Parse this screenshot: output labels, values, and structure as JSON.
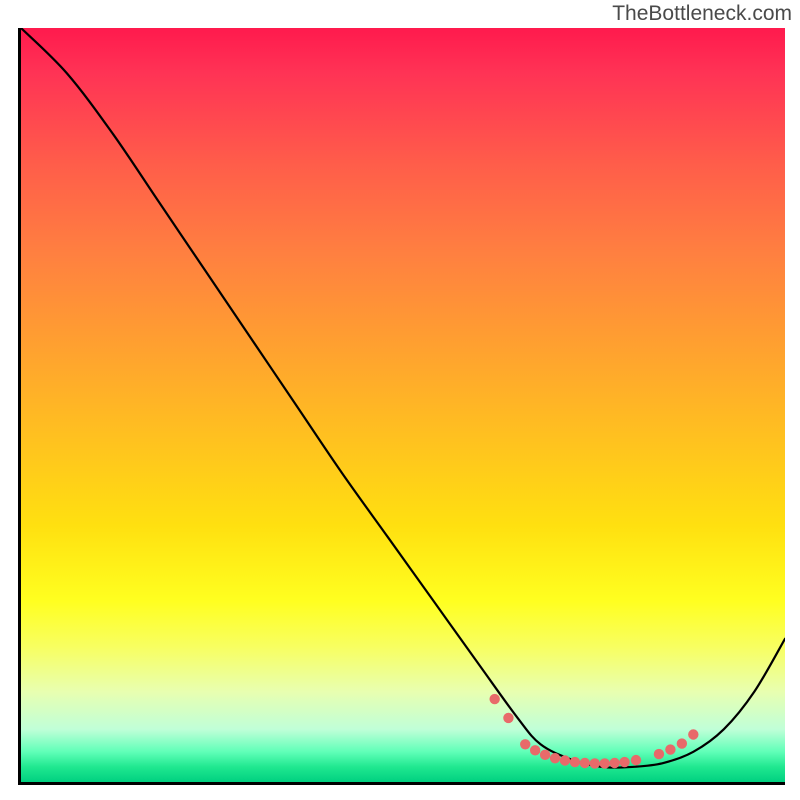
{
  "watermark": "TheBottleneck.com",
  "chart_data": {
    "type": "line",
    "title": "",
    "xlabel": "",
    "ylabel": "",
    "xlim": [
      0,
      100
    ],
    "ylim": [
      0,
      100
    ],
    "series": [
      {
        "name": "black-curve",
        "color": "#000000",
        "x": [
          0,
          6,
          12,
          18,
          24,
          30,
          36,
          42,
          48,
          54,
          60,
          65,
          68,
          72,
          76,
          80,
          84,
          88,
          92,
          96,
          100
        ],
        "values": [
          100,
          94,
          86,
          77,
          68,
          59,
          50,
          41,
          32.5,
          24,
          15.5,
          8.5,
          5,
          3,
          2,
          2,
          2.5,
          4,
          7,
          12,
          19
        ]
      }
    ],
    "highlight_points": {
      "name": "pink-dots",
      "color": "#e86a6a",
      "x": [
        62,
        63.8,
        66,
        67.3,
        68.6,
        69.9,
        71.2,
        72.5,
        73.8,
        75.1,
        76.4,
        77.7,
        79,
        80.5,
        83.5,
        85,
        86.5,
        88
      ],
      "values": [
        11,
        8.5,
        5,
        4.2,
        3.6,
        3.15,
        2.85,
        2.65,
        2.52,
        2.46,
        2.46,
        2.52,
        2.65,
        2.9,
        3.7,
        4.3,
        5.1,
        6.3
      ]
    }
  }
}
